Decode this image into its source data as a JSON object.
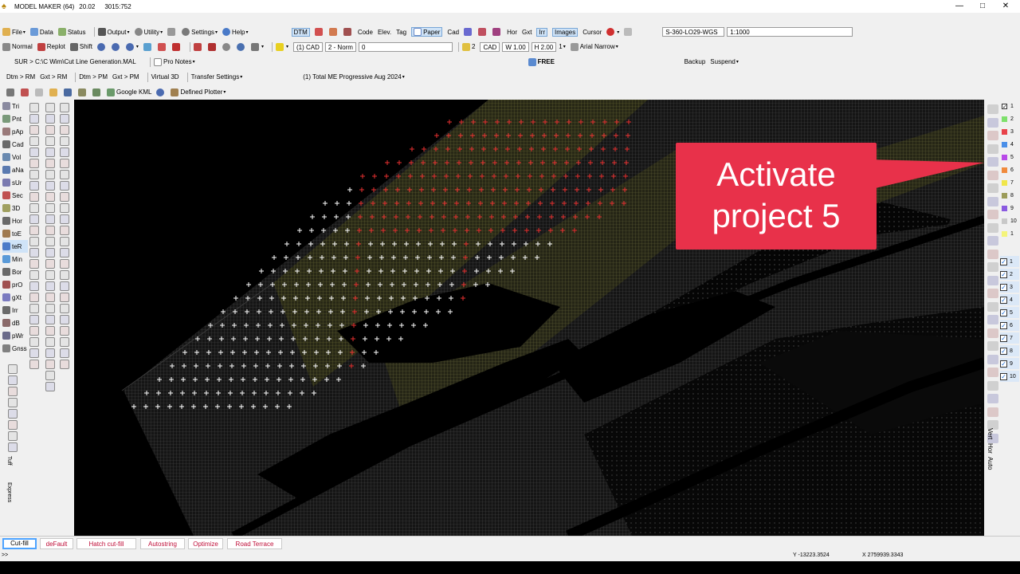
{
  "window": {
    "title": "MODEL MAKER (64)",
    "version": "20.02",
    "coords_display": "3015:752",
    "minimize_glyph": "—",
    "maximize_glyph": "□",
    "close_glyph": "✕"
  },
  "menubar": {
    "file": "File",
    "data": "Data",
    "status": "Status",
    "output": "Output",
    "utility": "Utility",
    "settings": "Settings",
    "help": "Help",
    "dtm": "DTM",
    "code": "Code",
    "elev": "Elev.",
    "tag": "Tag",
    "paper": "Paper",
    "cad": "Cad",
    "hor": "Hor",
    "gxt": "Gxt",
    "irr": "Irr",
    "images": "Images",
    "cursor": "Cursor",
    "coord_system": "S-360-LO29-WGS",
    "scale": "1:1000"
  },
  "toolbar2": {
    "normal": "Normal",
    "replot": "Replot",
    "shift": "Shift",
    "cad_layer": "(1) CAD",
    "norm": "2 - Norm",
    "line_value": "0",
    "text_size": "2",
    "cad": "CAD",
    "width": "W 1.00",
    "height": "H 2.00",
    "count": "1",
    "font": "Arial Narrow"
  },
  "toolbar3": {
    "path": "SUR > C:\\C Wim\\Cut Line Generation.MAL",
    "pro_notes": "Pro Notes",
    "free": "FREE",
    "backup": "Backup",
    "suspend": "Suspend"
  },
  "toolbar4": {
    "dtm_rm": "Dtm > RM",
    "gxt_rm": "Gxt > RM",
    "dtm_pm": "Dtm > PM",
    "gxt_pm": "Gxt > PM",
    "virtual3d": "Virtual 3D",
    "transfer": "Transfer Settings",
    "project": "(1) Total ME Progressive Aug 2024"
  },
  "toolbar5": {
    "google_kml": "Google KML",
    "defined_plotter": "Defined Plotter"
  },
  "left_palette": {
    "col1": [
      "Tri",
      "Pnt",
      "pAp",
      "Cad",
      "Vol",
      "aNa",
      "sUr",
      "Sec",
      "3D",
      "Hor",
      "toE",
      "teR",
      "Min",
      "Bor",
      "prO",
      "gXt",
      "Irr",
      "dB",
      "pWr",
      "Gnss"
    ],
    "col1_bottom": [
      "Tuff",
      "Express"
    ]
  },
  "right_palette": {
    "layers_a": [
      "1",
      "2",
      "3",
      "4",
      "5",
      "6",
      "7",
      "8",
      "9",
      "10",
      "1"
    ],
    "layers_a_colors": [
      "#ffffff",
      "#7ee06c",
      "#e8434a",
      "#4a8fe8",
      "#b84ae8",
      "#f08a3c",
      "#f0e64a",
      "#9c9c5a",
      "#8a5ae0",
      "#c8c8c8",
      "#f4f47a"
    ],
    "layers_b": [
      "1",
      "2",
      "3",
      "4",
      "5",
      "6",
      "7",
      "8",
      "9",
      "10"
    ],
    "vertical_labels": [
      "Vert",
      "Hor",
      "Auto"
    ]
  },
  "callout": {
    "line1": "Activate",
    "line2": "project 5"
  },
  "tabs": [
    "Cut-fill",
    "deFault",
    "Hatch cut-fill",
    "Autostring",
    "Optimize",
    "Road Terrace"
  ],
  "status": {
    "prompt": ">>",
    "y": "Y -13223.3524",
    "x": "X 2759939.3343"
  }
}
